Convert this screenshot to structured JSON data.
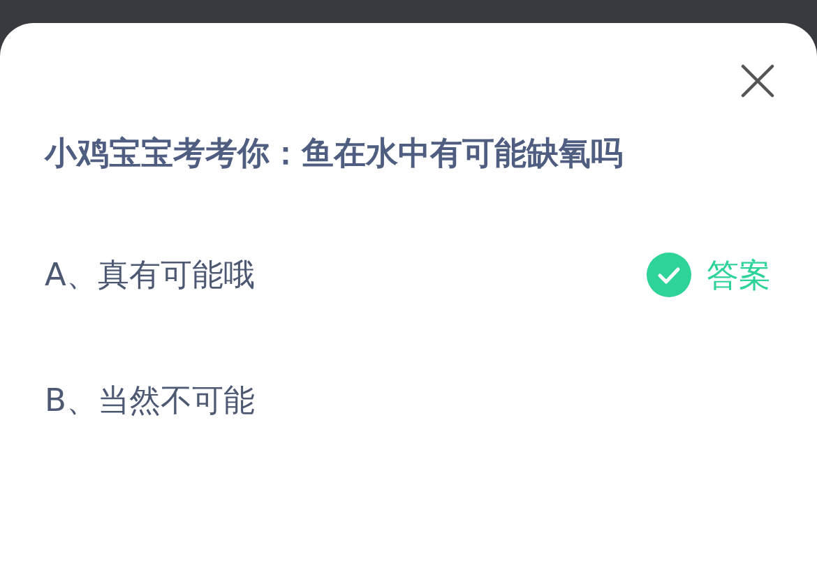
{
  "question": {
    "title": "小鸡宝宝考考你：鱼在水中有可能缺氧吗"
  },
  "options": [
    {
      "text": "A、真有可能哦",
      "correct": true
    },
    {
      "text": "B、当然不可能",
      "correct": false
    }
  ],
  "answer_badge": {
    "text": "答案"
  }
}
